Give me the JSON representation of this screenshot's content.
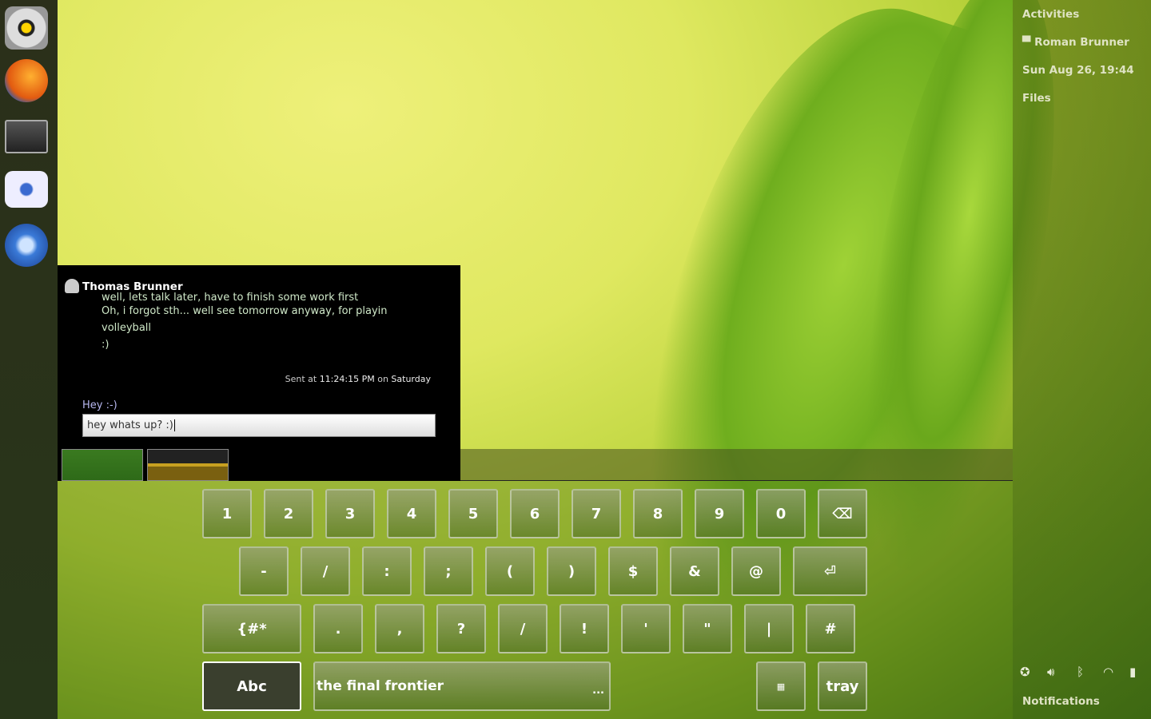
{
  "panel": {
    "activities": "Activities",
    "user": "Roman Brunner",
    "clock": "Sun Aug 26, 19:44",
    "files": "Files",
    "notifications": "Notifications"
  },
  "dock": [
    {
      "icon": "rhythmbox-icon"
    },
    {
      "icon": "firefox-icon"
    },
    {
      "icon": "terminal-icon"
    },
    {
      "icon": "empathy-chat-icon"
    },
    {
      "icon": "media-player-icon"
    }
  ],
  "chat": {
    "contact": "Thomas Brunner",
    "messages": [
      "well, lets talk later, have to finish some work first",
      "Oh, i forgot sth... well see tomorrow anyway, for playin",
      "volleyball",
      ":)"
    ],
    "sent_prefix": "Sent at ",
    "sent_time": "11:24:15 PM",
    "sent_on": " on ",
    "sent_day": "Saturday",
    "my_message": "Hey :-)",
    "input_value": "hey whats up? :)"
  },
  "keyboard": {
    "row1": [
      "1",
      "2",
      "3",
      "4",
      "5",
      "6",
      "7",
      "8",
      "9",
      "0",
      "⌫"
    ],
    "row2": [
      "-",
      "/",
      ":",
      ";",
      "(",
      ")",
      "$",
      "&",
      "@",
      "⏎"
    ],
    "row3": [
      "{#*",
      ".",
      ",",
      "?",
      "/",
      "!",
      "'",
      "\"",
      "|",
      "#"
    ],
    "abc": "Abc",
    "space": "the final frontier",
    "space_more": "...",
    "keyboard_icon": "▦",
    "tray": "tray"
  },
  "status_icons": [
    "accessibility-icon",
    "volume-icon",
    "bluetooth-icon",
    "wifi-icon",
    "battery-icon"
  ]
}
